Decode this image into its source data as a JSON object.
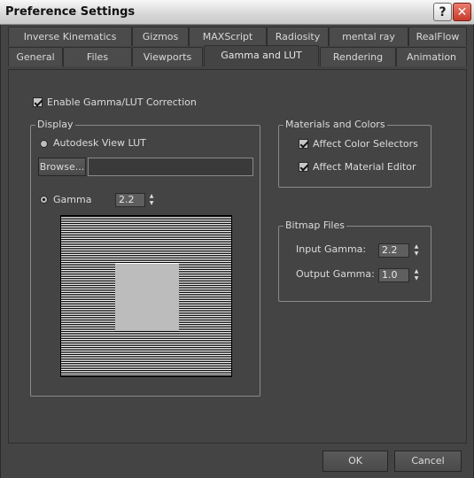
{
  "window": {
    "title": "Preference Settings"
  },
  "tabs_row1": [
    "Inverse Kinematics",
    "Gizmos",
    "MAXScript",
    "Radiosity",
    "mental ray",
    "RealFlow"
  ],
  "tabs_row2": [
    "General",
    "Files",
    "Viewports",
    "Gamma and LUT",
    "Rendering",
    "Animation"
  ],
  "active_tab": "Gamma and LUT",
  "enable_gamma": {
    "label": "Enable Gamma/LUT Correction",
    "checked": true
  },
  "display": {
    "title": "Display",
    "lut_radio_label": "Autodesk View LUT",
    "lut_selected": false,
    "browse_label": "Browse...",
    "lut_path": "",
    "gamma_radio_label": "Gamma",
    "gamma_selected": true,
    "gamma_value": "2.2"
  },
  "materials": {
    "title": "Materials and Colors",
    "affect_color_selectors": {
      "label": "Affect Color Selectors",
      "checked": true
    },
    "affect_material_editor": {
      "label": "Affect Material Editor",
      "checked": true
    }
  },
  "bitmap": {
    "title": "Bitmap Files",
    "input_gamma_label": "Input Gamma:",
    "input_gamma_value": "2.2",
    "output_gamma_label": "Output Gamma:",
    "output_gamma_value": "1.0"
  },
  "buttons": {
    "ok": "OK",
    "cancel": "Cancel"
  },
  "icons": {
    "help": "help-icon",
    "close": "close-icon"
  }
}
